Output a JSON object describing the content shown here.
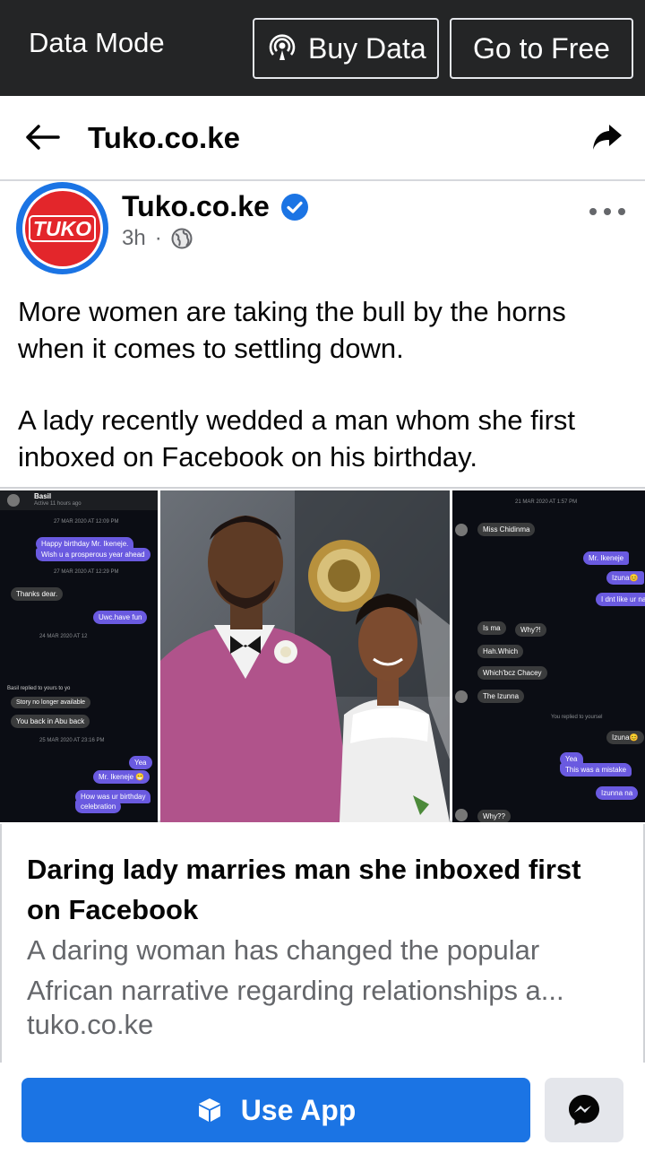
{
  "banner": {
    "mode_label": "Data Mode",
    "buy_label": "Buy Data",
    "free_label": "Go to Free"
  },
  "header": {
    "title": "Tuko.co.ke"
  },
  "post": {
    "page_name": "Tuko.co.ke",
    "logo_text": "TUKO",
    "time": "3h",
    "dot": "·",
    "paragraphs": [
      "More women are taking the bull by the horns when it comes to settling down.",
      "A lady recently wedded a man whom she first inboxed on Facebook on his birthday."
    ]
  },
  "images": {
    "left_chat": {
      "name": "Basil",
      "status": "Active 11 hours ago",
      "messages": [
        "Happy birthday Mr. Ikeneje.",
        "Wish u a prosperous year ahead",
        "Thanks dear.",
        "Uwc.have fun",
        "Story no longer available",
        "You back in Abu back",
        "Yea",
        "Mr. Ikeneje 😁",
        "How was ur birthday",
        "celebration"
      ],
      "times": [
        "27 MAR 2020 AT 12:09 PM",
        "27 MAR 2020 AT 12:29 PM",
        "24 MAR 2020 AT 12",
        "25 MAR 2020 AT 23:16 PM"
      ],
      "reply_note": "Basil replied to yours to yo"
    },
    "right_chat": {
      "time": "21 MAR 2020 AT 1:57 PM",
      "messages": [
        "Miss Chidinma",
        "Mr. Ikeneje",
        "Izuna😊",
        "I dnt like ur name",
        "Is ma",
        "Why?!",
        "Hah.Which",
        "Which'bcz Chacey",
        "The Izunna",
        "Izuna😊",
        "Yea",
        "This was a mistake",
        "Izunna na",
        "Why??"
      ],
      "reply_note": "You replied to yoursel"
    }
  },
  "link_preview": {
    "title": "Daring lady marries man she inboxed first on Facebook",
    "description": "A daring woman has changed the popular African narrative regarding relationships a...",
    "domain": "tuko.co.ke"
  },
  "bottom_bar": {
    "use_app_label": "Use App"
  },
  "colors": {
    "banner_bg": "#242526",
    "brand_blue": "#1b74e4",
    "tuko_red": "#e3262b",
    "secondary_text": "#65676b"
  }
}
